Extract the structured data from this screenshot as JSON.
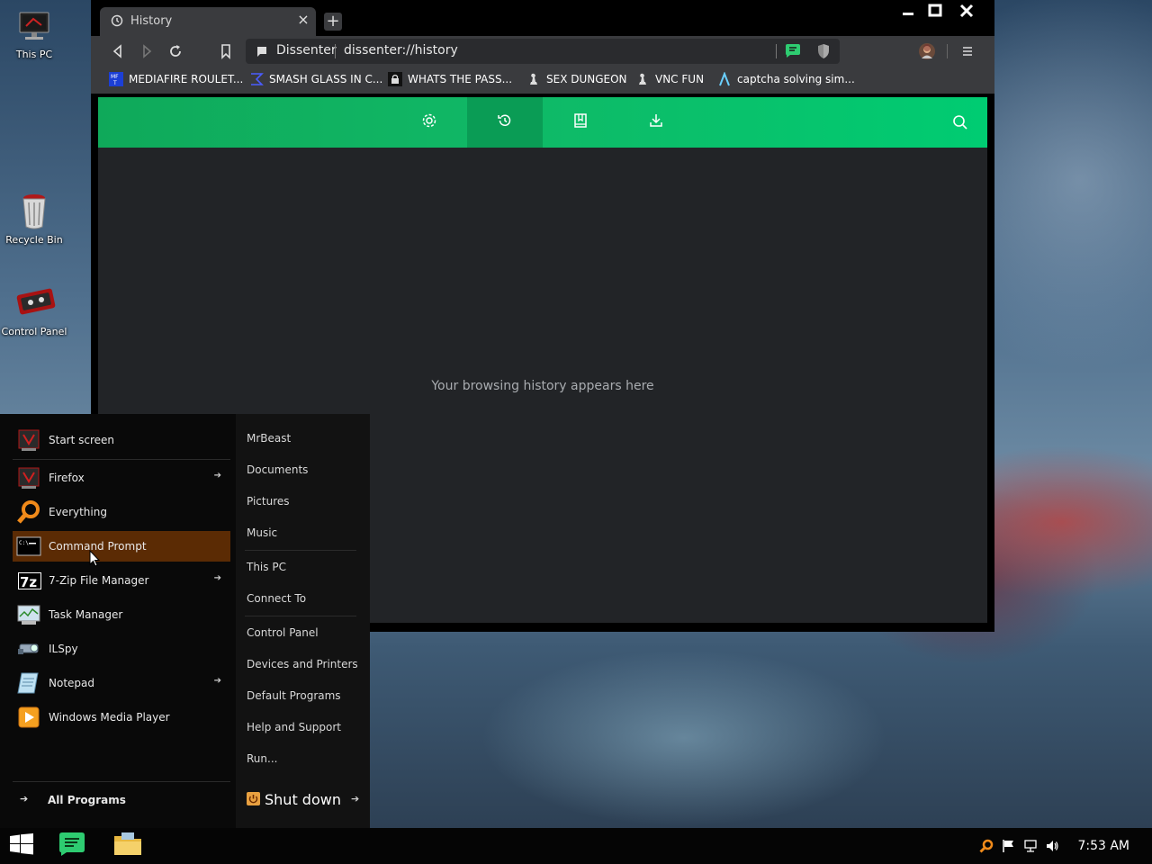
{
  "desktop": {
    "icons": [
      {
        "label": "This PC"
      },
      {
        "label": "Recycle Bin"
      },
      {
        "label": "Control Panel"
      }
    ]
  },
  "browser": {
    "tab": {
      "title": "History"
    },
    "omnibox": {
      "site_name": "Dissenter",
      "url": "dissenter://history"
    },
    "bookmarks": [
      {
        "label": "MEDIAFIRE ROULET..."
      },
      {
        "label": "SMASH GLASS IN C..."
      },
      {
        "label": "WHATS THE PASS..."
      },
      {
        "label": "SEX DUNGEON"
      },
      {
        "label": "VNC FUN"
      },
      {
        "label": "captcha solving sim..."
      }
    ],
    "page": {
      "empty_message": "Your browsing history appears here"
    },
    "colors": {
      "accent": "#10b866",
      "accent_active": "#0a9c55"
    }
  },
  "start_menu": {
    "programs": [
      {
        "label": "Start screen",
        "icon": "firefox-red-icon"
      },
      {
        "label": "Firefox",
        "icon": "firefox-red-icon",
        "submenu": true
      },
      {
        "label": "Everything",
        "icon": "magnifier-icon"
      },
      {
        "label": "Command Prompt",
        "icon": "cmd-icon",
        "highlighted": true
      },
      {
        "label": "7-Zip File Manager",
        "icon": "7zip-icon",
        "submenu": true
      },
      {
        "label": "Task Manager",
        "icon": "task-manager-icon"
      },
      {
        "label": "ILSpy",
        "icon": "ilspy-icon"
      },
      {
        "label": "Notepad",
        "icon": "notepad-icon",
        "submenu": true
      },
      {
        "label": "Windows Media Player",
        "icon": "media-player-icon"
      }
    ],
    "all_programs": "All Programs",
    "places": [
      {
        "label": "MrBeast"
      },
      {
        "label": "Documents"
      },
      {
        "label": "Pictures"
      },
      {
        "label": "Music"
      },
      {
        "label": "This PC"
      },
      {
        "label": "Connect To"
      },
      {
        "label": "Control Panel"
      },
      {
        "label": "Devices and Printers"
      },
      {
        "label": "Default Programs"
      },
      {
        "label": "Help and Support"
      },
      {
        "label": "Run..."
      }
    ],
    "shutdown": "Shut down"
  },
  "taskbar": {
    "clock": "7:53 AM"
  }
}
